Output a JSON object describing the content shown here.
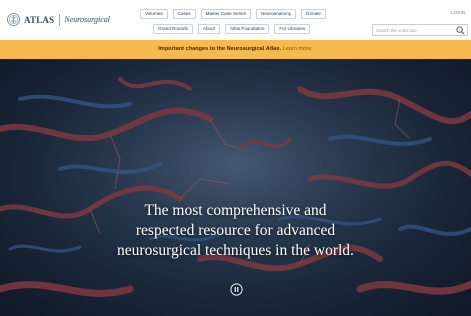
{
  "header": {
    "logo_word": "ATLAS",
    "logo_sub": "Neurosurgical",
    "login": "LOGIN",
    "nav_row1": [
      "Volumes",
      "Cases",
      "Master Case Series",
      "Neuroanatomy",
      "Donate"
    ],
    "nav_row2": [
      "Grand Rounds",
      "About",
      "Atlas Foundation",
      "For Libraries"
    ],
    "search_placeholder": "Search the entire site"
  },
  "notice": {
    "text_before": "Important changes to the Neurosurgical ",
    "text_em": "Atlas",
    "text_after": ". ",
    "link": "Learn more."
  },
  "hero": {
    "lines": [
      "The most comprehensive and",
      "respected resource for advanced",
      "neurosurgical techniques in the world."
    ]
  },
  "icons": {
    "search": "search-icon",
    "pause": "pause-icon",
    "logo": "atlas-seal-logo"
  },
  "colors": {
    "notice_bg": "#f6b94d",
    "brand_navy": "#2f4a6b",
    "hero_dark": "#1a2638"
  }
}
